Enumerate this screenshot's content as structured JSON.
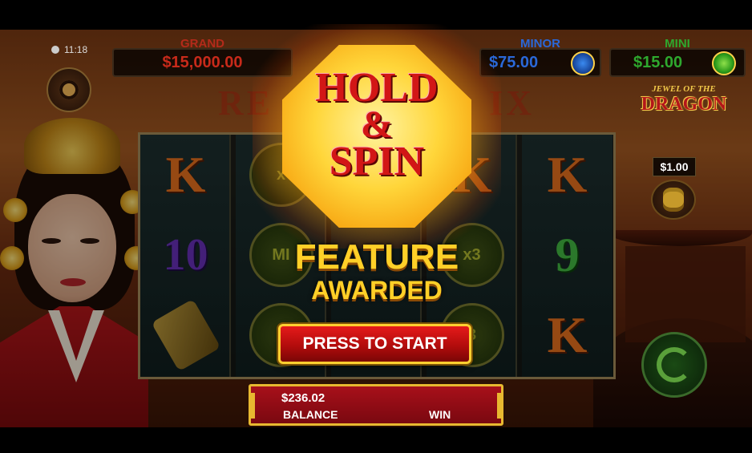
{
  "status": {
    "time": "11:18"
  },
  "jackpots": {
    "grand": {
      "label": "GRAND",
      "value": "$15,000.00",
      "color": "#c82a1a"
    },
    "minor": {
      "label": "MINOR",
      "value": "$75.00",
      "color": "#2a68d8"
    },
    "mini": {
      "label": "MINI",
      "value": "$15.00",
      "color": "#2ea82e"
    }
  },
  "title_logo": {
    "left": "RE",
    "right": "IX"
  },
  "brand_logo": {
    "top": "JEWEL OF THE",
    "main": "DRAGON"
  },
  "bet": {
    "value": "$1.00"
  },
  "reels": [
    [
      "K",
      "10",
      "scroll"
    ],
    [
      "x",
      "MI",
      "x"
    ],
    [
      "",
      "",
      ""
    ],
    [
      "K",
      "x3",
      "3"
    ],
    [
      "K",
      "9",
      "K"
    ]
  ],
  "feature": {
    "badge_line1": "HOLD",
    "badge_line2": "&",
    "badge_line3": "SPIN",
    "line1": "FEATURE",
    "line2": "AWARDED",
    "button": "PRESS TO START"
  },
  "balance": {
    "amount": "$236.02",
    "label": "BALANCE",
    "win_label": "WIN"
  }
}
